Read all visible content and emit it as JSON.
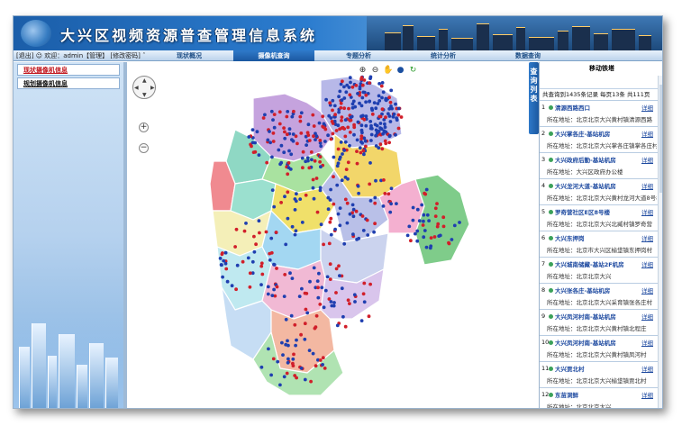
{
  "app": {
    "title": "大兴区视频资源普查管理信息系统"
  },
  "userbar": {
    "exit_label": "[退出]",
    "welcome_text": "欢迎：admin【管理】",
    "change_password_label": "[修改密码]"
  },
  "tabs": [
    "现状概况",
    "摄像机查询",
    "专题分析",
    "统计分析",
    "数据查询"
  ],
  "active_tab_index": 1,
  "sidebar": {
    "items": [
      {
        "label": "现状摄像机信息"
      },
      {
        "label": "规划摄像机信息"
      }
    ]
  },
  "right_panel": {
    "tab_label": "查询列表",
    "title": "移动铁塔",
    "summary": "共查询到1435条记录   每页13条   共111页",
    "address_prefix": "所在地址：",
    "detail_label": "详细",
    "results": [
      {
        "num": "1",
        "name": "清源西路西口",
        "address": "北京北京大兴黄村镇清源西路"
      },
      {
        "num": "2",
        "name": "大兴掌各庄-基站机房",
        "address": "北京北京大兴掌各庄镇掌各庄村"
      },
      {
        "num": "3",
        "name": "大兴政府后勤-基站机房",
        "address": "大兴区政府办公楼"
      },
      {
        "num": "4",
        "name": "大兴龙河大道-基站机房",
        "address": "北京北京大兴黄村龙河大道8号楼"
      },
      {
        "num": "5",
        "name": "罗奇营社区E区8号楼",
        "address": "北京北京大兴北臧村镇罗奇营"
      },
      {
        "num": "6",
        "name": "大兴东押岗",
        "address": "北京市大兴区榆垡镇东押岗村"
      },
      {
        "num": "7",
        "name": "大兴城南储藏-基站2F机房",
        "address": "北京北京大兴"
      },
      {
        "num": "8",
        "name": "大兴张各庄-基站机房",
        "address": "北京北京大兴采育镇张各庄村"
      },
      {
        "num": "9",
        "name": "大兴凤河村南-基站机房",
        "address": "北京北京大兴黄村镇北程庄"
      },
      {
        "num": "10",
        "name": "大兴凤河村南-基站机房",
        "address": "北京北京大兴黄村镇凤河村"
      },
      {
        "num": "11",
        "name": "大兴贾北村",
        "address": "北京北京大兴榆垡镇贾北村"
      },
      {
        "num": "12",
        "name": "东苗洞鲜",
        "address": "北京北京大兴"
      }
    ]
  },
  "colors": {
    "accent": "#1b58a0",
    "banner": "#2b7ccf",
    "camera_blue": "#1f3fb0",
    "camera_red": "#d11f2a"
  },
  "icons": [
    "zoom-in-icon",
    "zoom-out-icon",
    "pan-hand-icon",
    "globe-icon",
    "refresh-icon"
  ]
}
